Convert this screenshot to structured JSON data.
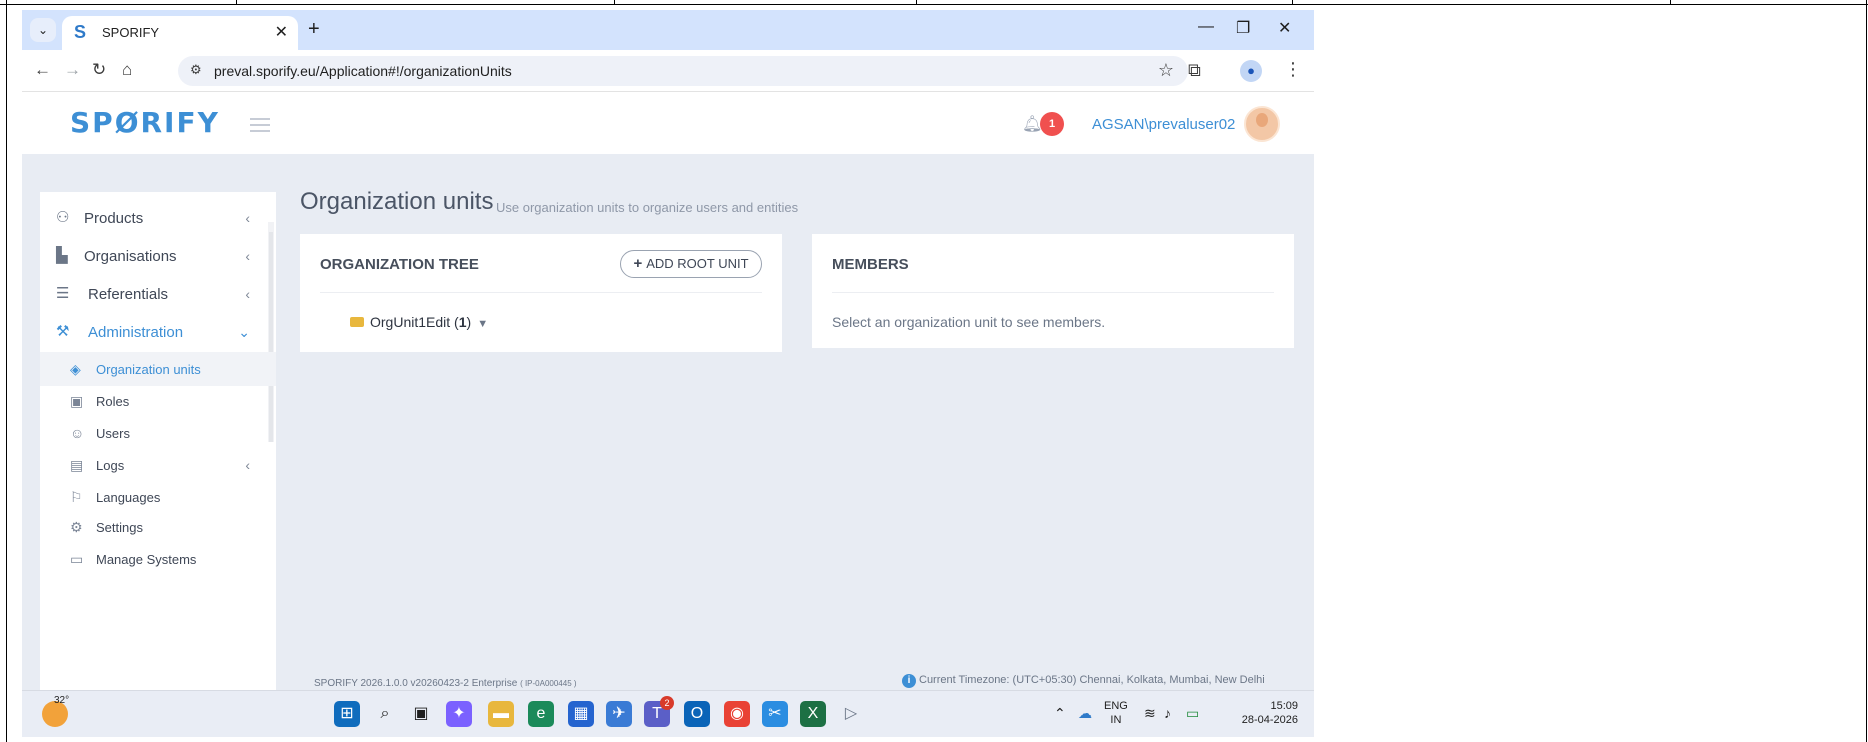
{
  "browser": {
    "tab_title": "SPORIFY",
    "tab_favicon": "S",
    "tab_close": "✕",
    "new_tab": "+",
    "tab_menu": "⌄",
    "url": "preval.sporify.eu/Application#!/organizationUnits",
    "window_controls": {
      "minimize": "—",
      "restore": "❐",
      "close": "✕"
    }
  },
  "header": {
    "logo_text_1": "SP",
    "logo_text_2": "Ø",
    "logo_text_3": "RIFY",
    "notification_count": "1",
    "username": "AGSAN\\prevaluser02"
  },
  "sidebar": {
    "items": [
      {
        "label": "Products",
        "icon": "products-icon",
        "glyph": "⚇"
      },
      {
        "label": "Organisations",
        "icon": "factory-icon",
        "glyph": "▙"
      },
      {
        "label": "Referentials",
        "icon": "list-icon",
        "glyph": "☰"
      },
      {
        "label": "Administration",
        "icon": "wrench-icon",
        "glyph": "🔧"
      }
    ],
    "sub_items": [
      {
        "label": "Organization units",
        "icon": "layers-icon",
        "glyph": "◈"
      },
      {
        "label": "Roles",
        "icon": "briefcase-icon",
        "glyph": "▣"
      },
      {
        "label": "Users",
        "icon": "users-icon",
        "glyph": "☺"
      },
      {
        "label": "Logs",
        "icon": "book-icon",
        "glyph": "▤"
      },
      {
        "label": "Languages",
        "icon": "flag-icon",
        "glyph": "⚐"
      },
      {
        "label": "Settings",
        "icon": "gear-icon",
        "glyph": "⚙"
      },
      {
        "label": "Manage Systems",
        "icon": "laptop-icon",
        "glyph": "▭"
      }
    ]
  },
  "main": {
    "title": "Organization units",
    "subtitle": "Use organization units to organize users and entities",
    "tree_panel": {
      "title": "ORGANIZATION TREE",
      "add_button": "ADD ROOT UNIT",
      "node_label": "OrgUnit1Edit",
      "node_count": "1"
    },
    "members_panel": {
      "title": "MEMBERS",
      "hint": "Select an organization unit to see members."
    }
  },
  "footer": {
    "version": "SPORIFY 2026.1.0.0 v20260423-2 Enterprise",
    "build": "( IP-0A000445 )",
    "timezone": "Current Timezone: (UTC+05:30) Chennai, Kolkata, Mumbai, New Delhi"
  },
  "taskbar": {
    "temperature": "32°",
    "teams_badge": "2",
    "lang_line1": "ENG",
    "lang_line2": "IN",
    "time": "15:09",
    "date": "28-04-2026"
  },
  "colors": {
    "accent": "#3d8fd5",
    "badge": "#f0504f",
    "folder": "#e8b73d"
  }
}
